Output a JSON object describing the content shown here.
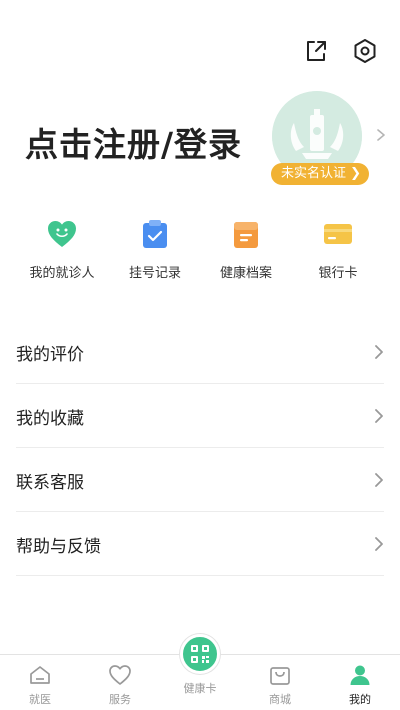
{
  "header": {
    "share_icon": "share-icon",
    "settings_icon": "settings-gear-icon"
  },
  "profile": {
    "login_text": "点击注册/登录",
    "avatar_icon": "hospital-emblem-icon",
    "verify_badge": "未实名认证",
    "verify_arrow": "❯"
  },
  "quick_actions": [
    {
      "label": "我的就诊人",
      "icon": "heart-icon",
      "color": "#3fc58e"
    },
    {
      "label": "挂号记录",
      "icon": "clipboard-check-icon",
      "color": "#4a8ef0"
    },
    {
      "label": "健康档案",
      "icon": "folder-icon",
      "color": "#f49a3e"
    },
    {
      "label": "银行卡",
      "icon": "card-icon",
      "color": "#f5c447"
    }
  ],
  "menu": [
    {
      "label": "我的评价"
    },
    {
      "label": "我的收藏"
    },
    {
      "label": "联系客服"
    },
    {
      "label": "帮助与反馈"
    }
  ],
  "tabbar": {
    "tabs": [
      {
        "label": "就医",
        "icon": "home-icon"
      },
      {
        "label": "服务",
        "icon": "heart-outline-icon"
      },
      {
        "label": "健康卡",
        "icon": "qr-code-icon"
      },
      {
        "label": "商城",
        "icon": "shopping-bag-icon"
      },
      {
        "label": "我的",
        "icon": "person-icon"
      }
    ],
    "active": "我的"
  },
  "colors": {
    "accent": "#3fc58e",
    "badge": "#f1b233",
    "avatar_bg": "#d4ebe1"
  }
}
